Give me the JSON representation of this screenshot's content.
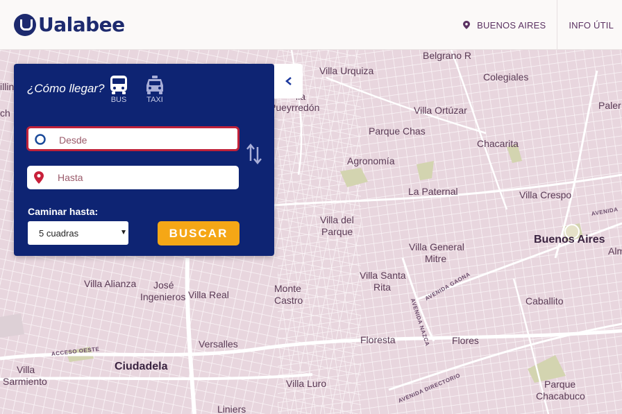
{
  "header": {
    "logo_text": "Ualabee",
    "city": "BUENOS AIRES",
    "info": "INFO ÚTIL"
  },
  "panel": {
    "question": "¿Cómo llegar?",
    "mode_bus": "BUS",
    "mode_taxi": "TAXI",
    "from_placeholder": "Desde",
    "to_placeholder": "Hasta",
    "walk_label": "Caminar hasta:",
    "walk_value": "5 cuadras",
    "search_label": "BUSCAR"
  },
  "map": {
    "labels": {
      "belgrano_r": "Belgrano R",
      "villa_urquiza": "Villa Urquiza",
      "colegiales": "Colegiales",
      "palermo": "Paler",
      "pueyrredon": "Pueyrredón",
      "villa_ortuzar": "Villa Ortúzar",
      "parque_chas": "Parque Chas",
      "chacarita": "Chacarita",
      "agronomia": "Agronomía",
      "la_paternal": "La Paternal",
      "villa_crespo": "Villa Crespo",
      "villa_del_parque_1": "Villa del",
      "villa_del_parque_2": "Parque",
      "buenos_aires": "Buenos Aires",
      "almagro": "Alm",
      "villa_general_mitre_1": "Villa General",
      "villa_general_mitre_2": "Mitre",
      "villa_santa_rita_1": "Villa Santa",
      "villa_santa_rita_2": "Rita",
      "villa_alianza": "Villa Alianza",
      "jose_ingenieros_1": "José",
      "jose_ingenieros_2": "Ingenieros",
      "villa_real": "Villa Real",
      "monte_castro_1": "Monte",
      "monte_castro_2": "Castro",
      "caballito": "Caballito",
      "versalles": "Versalles",
      "floresta": "Floresta",
      "flores": "Flores",
      "villa_sarmiento_1": "Villa",
      "villa_sarmiento_2": "Sarmiento",
      "ciudadela": "Ciudadela",
      "villa_luro": "Villa Luro",
      "parque_chacabuco_1": "Parque",
      "parque_chacabuco_2": "Chacabuco",
      "liniers": "Liniers",
      "left_top": "illin",
      "left_mid": "ch",
      "villa_edge": "lla"
    },
    "roads": {
      "acceso_oeste": "ACCESO OESTE",
      "avenida_gaona": "AVENIDA GAONA",
      "avenida_nazca": "AVENIDA NAZCA",
      "avenida_directorio": "AVENIDA DIRECTORIO",
      "avenida_right": "AVENIDA"
    }
  },
  "colors": {
    "panel_bg": "#0e2473",
    "accent": "#f5a716",
    "brand": "#1d2a6e",
    "error_border": "#c0223a"
  },
  "icons": {
    "from": "origin-circle-icon",
    "to": "destination-pin-icon",
    "swap": "swap-arrows-icon",
    "collapse": "chevron-left-icon",
    "bus": "bus-icon",
    "taxi": "taxi-icon",
    "location": "location-pin-icon"
  }
}
